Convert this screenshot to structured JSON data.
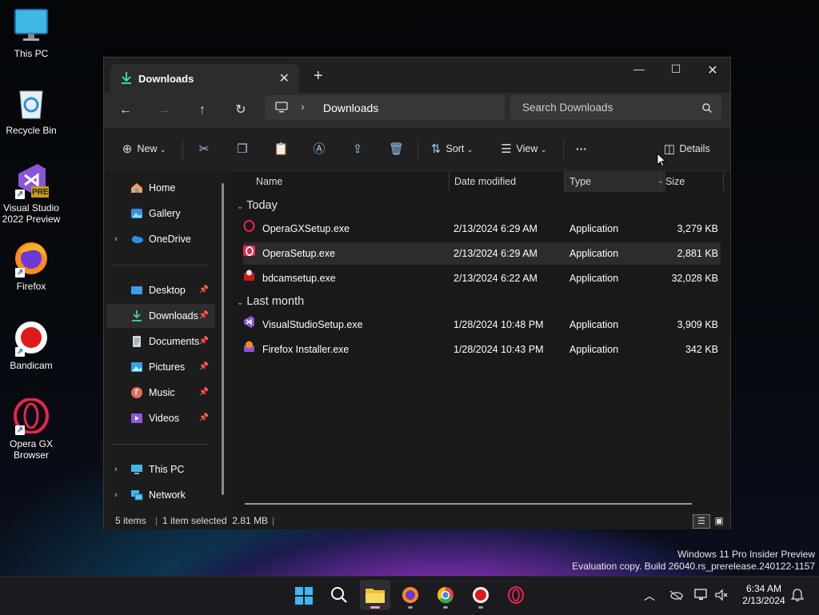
{
  "desktop": {
    "icons": [
      {
        "label": "This PC",
        "icon": "monitor-icon"
      },
      {
        "label": "Recycle Bin",
        "icon": "recycle-bin-icon"
      },
      {
        "label": "Visual Studio 2022 Preview",
        "icon": "visual-studio-icon",
        "badge": "PRE"
      },
      {
        "label": "Firefox",
        "icon": "firefox-icon"
      },
      {
        "label": "Bandicam",
        "icon": "bandicam-icon"
      },
      {
        "label": "Opera GX Browser",
        "icon": "opera-gx-icon"
      }
    ]
  },
  "window": {
    "tab_title": "Downloads",
    "new_tab": "+",
    "address": {
      "root_icon": "monitor-icon",
      "separator": "›",
      "folder": "Downloads"
    },
    "search_placeholder": "Search Downloads",
    "commands": {
      "new": "New",
      "sort": "Sort",
      "view": "View",
      "more": "···",
      "details": "Details"
    },
    "sidebar": {
      "items": [
        {
          "label": "Home",
          "icon": "home-icon"
        },
        {
          "label": "Gallery",
          "icon": "gallery-icon"
        },
        {
          "label": "OneDrive",
          "icon": "onedrive-icon"
        },
        {
          "label": "Desktop",
          "icon": "desktop-folder-icon"
        },
        {
          "label": "Downloads",
          "icon": "download-icon"
        },
        {
          "label": "Documents",
          "icon": "documents-icon"
        },
        {
          "label": "Pictures",
          "icon": "pictures-icon"
        },
        {
          "label": "Music",
          "icon": "music-icon"
        },
        {
          "label": "Videos",
          "icon": "videos-icon"
        },
        {
          "label": "This PC",
          "icon": "monitor-icon"
        },
        {
          "label": "Network",
          "icon": "network-icon"
        }
      ]
    },
    "columns": {
      "name": "Name",
      "date": "Date modified",
      "type": "Type",
      "size": "Size"
    },
    "groups": [
      {
        "label": "Today",
        "files": [
          {
            "name": "OperaGXSetup.exe",
            "date": "2/13/2024 6:29 AM",
            "type": "Application",
            "size": "3,279 KB"
          },
          {
            "name": "OperaSetup.exe",
            "date": "2/13/2024 6:29 AM",
            "type": "Application",
            "size": "2,881 KB",
            "selected": true
          },
          {
            "name": "bdcamsetup.exe",
            "date": "2/13/2024 6:22 AM",
            "type": "Application",
            "size": "32,028 KB"
          }
        ]
      },
      {
        "label": "Last month",
        "files": [
          {
            "name": "VisualStudioSetup.exe",
            "date": "1/28/2024 10:48 PM",
            "type": "Application",
            "size": "3,909 KB"
          },
          {
            "name": "Firefox Installer.exe",
            "date": "1/28/2024 10:43 PM",
            "type": "Application",
            "size": "342 KB"
          }
        ]
      }
    ],
    "status": {
      "items": "5 items",
      "selection": "1 item selected  2.81 MB"
    }
  },
  "watermark": {
    "line1": "Windows 11 Pro Insider Preview",
    "line2": "Evaluation copy. Build 26040.rs_prerelease.240122-1157"
  },
  "taskbar": {
    "apps": [
      "windows-start-icon",
      "search-icon",
      "file-explorer-icon",
      "firefox-icon",
      "chrome-icon",
      "bandicam-icon",
      "opera-gx-icon"
    ],
    "time": "6:34 AM",
    "date": "2/13/2024"
  },
  "colors": {
    "accent": "#4cc2ff",
    "selection": "#2c2c2c",
    "window_bg": "#191919"
  }
}
